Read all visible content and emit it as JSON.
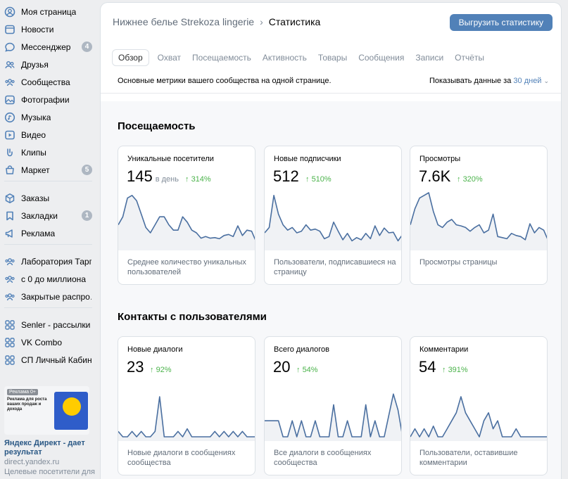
{
  "sidebar": {
    "groups": [
      [
        {
          "label": "Моя страница",
          "icon": "user-circle-icon"
        },
        {
          "label": "Новости",
          "icon": "news-icon"
        },
        {
          "label": "Мессенджер",
          "icon": "message-icon",
          "badge": "4"
        },
        {
          "label": "Друзья",
          "icon": "friends-icon"
        },
        {
          "label": "Сообщества",
          "icon": "communities-icon"
        },
        {
          "label": "Фотографии",
          "icon": "photo-icon"
        },
        {
          "label": "Музыка",
          "icon": "music-icon"
        },
        {
          "label": "Видео",
          "icon": "video-icon"
        },
        {
          "label": "Клипы",
          "icon": "clips-icon"
        },
        {
          "label": "Маркет",
          "icon": "market-icon",
          "badge": "5"
        }
      ],
      [
        {
          "label": "Заказы",
          "icon": "orders-icon"
        },
        {
          "label": "Закладки",
          "icon": "bookmark-icon",
          "badge": "1"
        },
        {
          "label": "Реклама",
          "icon": "ads-icon"
        }
      ],
      [
        {
          "label": "Лаборатория Тарг…",
          "icon": "group-icon"
        },
        {
          "label": "с 0 до миллиона",
          "icon": "group-icon"
        },
        {
          "label": "Закрытые распро…",
          "icon": "group-icon"
        }
      ],
      [
        {
          "label": "Senler - рассылки …",
          "icon": "app-icon"
        },
        {
          "label": "VK Combo",
          "icon": "app-icon"
        },
        {
          "label": "СП Личный Кабин…",
          "icon": "app-icon"
        }
      ]
    ],
    "ad": {
      "badge": "Реклама 0+",
      "image_text": "Реклама для роста ваших продаж и дохода",
      "title": "Яндекс Директ - дает результат",
      "domain": "direct.yandex.ru",
      "desc": "Целевые посетители для"
    }
  },
  "header": {
    "crumb": "Нижнее белье Strekoza lingerie",
    "current": "Статистика",
    "export_label": "Выгрузить статистику"
  },
  "tabs": [
    "Обзор",
    "Охват",
    "Посещаемость",
    "Активность",
    "Товары",
    "Сообщения",
    "Записи",
    "Отчёты"
  ],
  "subbar": {
    "desc": "Основные метрики вашего сообщества на одной странице.",
    "period_prefix": "Показывать данные за",
    "period_value": "30 дней"
  },
  "sections": [
    {
      "title": "Посещаемость",
      "cards": [
        {
          "title": "Уникальные посетители",
          "value": "145",
          "unit": "в день",
          "delta": "314%",
          "desc": "Среднее количество уникальных пользователей",
          "series": [
            40,
            55,
            90,
            95,
            85,
            60,
            35,
            25,
            40,
            55,
            55,
            40,
            30,
            30,
            55,
            45,
            30,
            25,
            15,
            18,
            15,
            16,
            14,
            20,
            22,
            18,
            38,
            20,
            30,
            28,
            8
          ]
        },
        {
          "title": "Новые подписчики",
          "value": "512",
          "unit": "",
          "delta": "510%",
          "desc": "Пользователи, подписавшиеся на страницу",
          "series": [
            25,
            35,
            95,
            60,
            40,
            30,
            35,
            25,
            28,
            40,
            30,
            32,
            28,
            14,
            18,
            45,
            28,
            12,
            24,
            10,
            16,
            12,
            24,
            14,
            38,
            20,
            34,
            25,
            26,
            10,
            22
          ]
        },
        {
          "title": "Просмотры",
          "value": "7.6K",
          "unit": "",
          "delta": "320%",
          "desc": "Просмотры страницы",
          "series": [
            40,
            70,
            90,
            95,
            100,
            65,
            40,
            35,
            45,
            50,
            40,
            38,
            35,
            28,
            35,
            40,
            25,
            30,
            60,
            18,
            16,
            14,
            24,
            20,
            18,
            12,
            42,
            25,
            35,
            30,
            10
          ]
        }
      ]
    },
    {
      "title": "Контакты с пользователями",
      "cards": [
        {
          "title": "Новые диалоги",
          "value": "23",
          "unit": "",
          "delta": "92%",
          "desc": "Новые диалоги в сообщениях сообщества",
          "series": [
            10,
            0,
            0,
            10,
            0,
            10,
            0,
            0,
            10,
            75,
            0,
            0,
            0,
            10,
            0,
            15,
            0,
            0,
            0,
            0,
            0,
            10,
            0,
            10,
            0,
            10,
            0,
            10,
            0,
            0,
            0
          ]
        },
        {
          "title": "Всего диалогов",
          "value": "20",
          "unit": "",
          "delta": "54%",
          "desc": "Все диалоги в сообщениях сообщества",
          "series": [
            30,
            30,
            30,
            30,
            0,
            0,
            30,
            0,
            30,
            0,
            0,
            30,
            0,
            0,
            0,
            60,
            0,
            0,
            30,
            0,
            0,
            0,
            60,
            0,
            30,
            0,
            0,
            40,
            80,
            50,
            0
          ]
        },
        {
          "title": "Комментарии",
          "value": "54",
          "unit": "",
          "delta": "391%",
          "desc": "Пользователи, оставившие комментарии",
          "series": [
            0,
            15,
            0,
            15,
            0,
            20,
            0,
            0,
            15,
            30,
            45,
            75,
            45,
            30,
            15,
            0,
            30,
            45,
            15,
            30,
            0,
            0,
            0,
            15,
            0,
            0,
            0,
            0,
            0,
            0,
            0
          ]
        }
      ]
    }
  ]
}
